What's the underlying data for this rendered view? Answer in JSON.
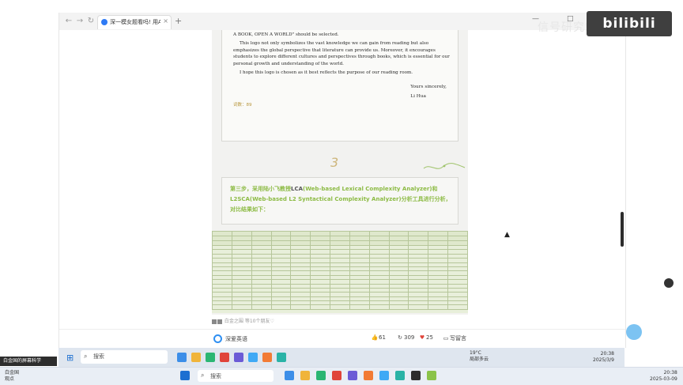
{
  "status_bar": {
    "left_text": ""
  },
  "browser": {
    "tab_title": "深一模女题看吗! 用AI上元",
    "tab_close": "×",
    "new_tab": "+",
    "nav_back": "←",
    "nav_forward": "→",
    "nav_refresh": "↻",
    "win_min": "—",
    "win_max": "□",
    "win_close": "×"
  },
  "letter": {
    "line_1": "A BOOK, OPEN A WORLD\" should be selected.",
    "paragraph_2": "This logo not only symbolizes the vast knowledge we can gain from reading but also emphasizes the global perspective that literature can provide us. Moreover, it encourages students to explore different cultures and perspectives through books, which is essential for our personal growth and understanding of the world.",
    "paragraph_3": "I hope this logo is chosen as it best reflects the purpose of our reading room.",
    "closing": "Yours sincerely,",
    "signature": "Li Hua",
    "word_count": "词数：89"
  },
  "page_number": "3",
  "step": {
    "prefix": "第三步，采用陆小飞教授",
    "lca": "LCA",
    "body": "(Web-based Lexical Complexity Analyzer)和L2SCA(Web-based L2 Syntactical Complexity Analyzer)分析工具进行分析，对比结果如下："
  },
  "readers": {
    "text": "白金之围 等10个朋友♡"
  },
  "footer": {
    "author": "深爱英语",
    "likes": "61",
    "shares": "309",
    "hearts": "25",
    "comment_placeholder": "写留言"
  },
  "watermark": {
    "text": "信号研究站",
    "bili": "bilibili"
  },
  "taskbar_inner": {
    "search_placeholder": "搜索",
    "weather_temp": "19°C",
    "weather_desc": "局部多云",
    "time": "20:38",
    "date": "2025/3/9"
  },
  "news_pill": {
    "text": "白金国的屏幕科学"
  },
  "taskbar_outer": {
    "user_line1": "白金国",
    "user_line2": "观点",
    "search_placeholder": "搜索",
    "time": "20:38",
    "date": "2025-03-09"
  },
  "icons": {
    "search": "⌕",
    "start": "⊞",
    "like": "👍",
    "share": "↻",
    "heart": "♥",
    "comment": "▭",
    "cursor": "▲"
  },
  "colors": {
    "step_text": "#8dbb45",
    "bili_bg": "#3f3f3f",
    "like_red": "#e0443a",
    "heart_red": "#e0443a",
    "author_blue": "#2f8ff2"
  }
}
